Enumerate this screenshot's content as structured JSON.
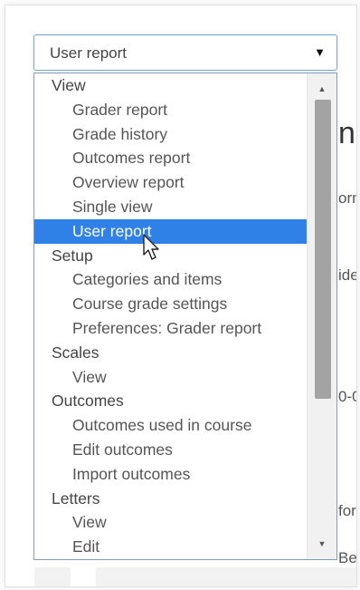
{
  "background": {
    "fragments": [
      "n",
      "orm",
      "ide",
      "0-0",
      "for",
      "Bel"
    ]
  },
  "select": {
    "value": "User report",
    "caret_icon": "▼"
  },
  "dropdown": {
    "options": [
      {
        "label": "View",
        "type": "group"
      },
      {
        "label": "Grader report",
        "type": "option"
      },
      {
        "label": "Grade history",
        "type": "option"
      },
      {
        "label": "Outcomes report",
        "type": "option"
      },
      {
        "label": "Overview report",
        "type": "option"
      },
      {
        "label": "Single view",
        "type": "option"
      },
      {
        "label": "User report",
        "type": "option",
        "selected": true
      },
      {
        "label": "Setup",
        "type": "group"
      },
      {
        "label": "Categories and items",
        "type": "option"
      },
      {
        "label": "Course grade settings",
        "type": "option"
      },
      {
        "label": "Preferences: Grader report",
        "type": "option"
      },
      {
        "label": "Scales",
        "type": "group"
      },
      {
        "label": "View",
        "type": "option"
      },
      {
        "label": "Outcomes",
        "type": "group"
      },
      {
        "label": "Outcomes used in course",
        "type": "option"
      },
      {
        "label": "Edit outcomes",
        "type": "option"
      },
      {
        "label": "Import outcomes",
        "type": "option"
      },
      {
        "label": "Letters",
        "type": "group"
      },
      {
        "label": "View",
        "type": "option"
      },
      {
        "label": "Edit",
        "type": "option"
      }
    ],
    "scroll_up_icon": "▲",
    "scroll_down_icon": "▼"
  },
  "colors": {
    "selected_bg": "#2f80e7",
    "select_border": "#7ea4d4"
  },
  "icons": {
    "cursor": "arrow-pointer-icon"
  }
}
